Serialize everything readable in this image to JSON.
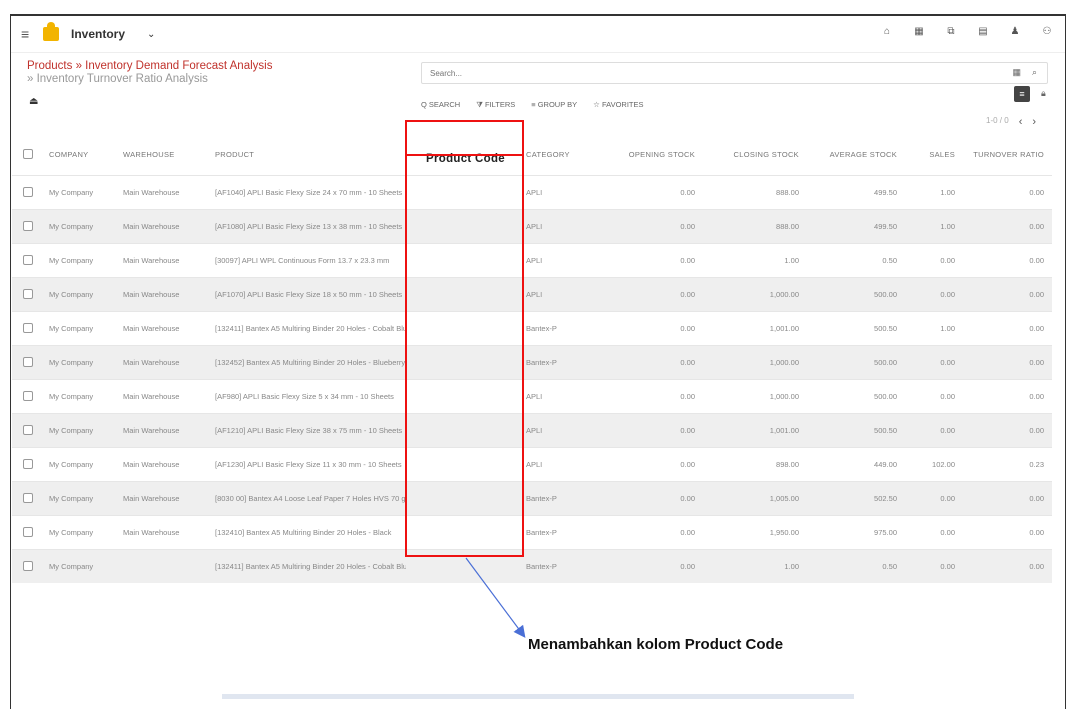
{
  "header": {
    "app_title": "Inventory",
    "menu_icon": "menu-icon",
    "app_icon": "inventory-app-icon",
    "dropdown_icon": "chevron-down-icon",
    "right_icons": [
      "home-icon",
      "grid-icon",
      "apps-icon",
      "chat-icon",
      "bell-icon",
      "avatar"
    ],
    "right_glyphs": [
      "⌂",
      "▦",
      "⧉",
      "▤",
      "♟",
      "⚇"
    ]
  },
  "breadcrumb": {
    "part1": "Products » Inventory Demand Forecast Analysis",
    "part2": "» Inventory Turnover Ratio Analysis"
  },
  "search": {
    "placeholder": "Search..."
  },
  "toolbar": {
    "search_label": "Q SEARCH",
    "filters_label": "⧩ FILTERS",
    "groupby_label": "≡ GROUP BY",
    "favorites_label": "☆ FAVORITES"
  },
  "pager": {
    "text": "1-0 / 0",
    "prev": "‹",
    "next": "›"
  },
  "table": {
    "headers": [
      "COMPANY",
      "WAREHOUSE",
      "PRODUCT",
      "Product Code",
      "CATEGORY",
      "OPENING STOCK",
      "CLOSING STOCK",
      "AVERAGE STOCK",
      "SALES",
      "TURNOVER RATIO"
    ],
    "rows": [
      [
        "My Company",
        "Main Warehouse",
        "[AF1040] APLI Basic Flexy Size 24 x 70 mm - 10 Sheets",
        "",
        "APLI",
        "0.00",
        "888.00",
        "499.50",
        "1.00",
        "0.00"
      ],
      [
        "My Company",
        "Main Warehouse",
        "[AF1080] APLI Basic Flexy Size 13 x 38 mm - 10 Sheets",
        "",
        "APLI",
        "0.00",
        "888.00",
        "499.50",
        "1.00",
        "0.00"
      ],
      [
        "My Company",
        "Main Warehouse",
        "[30097] APLI WPL Continuous Form 13.7 x 23.3 mm",
        "",
        "APLI",
        "0.00",
        "1.00",
        "0.50",
        "0.00",
        "0.00"
      ],
      [
        "My Company",
        "Main Warehouse",
        "[AF1070] APLI Basic Flexy Size 18 x 50 mm - 10 Sheets",
        "",
        "APLI",
        "0.00",
        "1,000.00",
        "500.00",
        "0.00",
        "0.00"
      ],
      [
        "My Company",
        "Main Warehouse",
        "[132411] Bantex A5 Multiring Binder 20 Holes - Cobalt Blue",
        "",
        "Bantex-P",
        "0.00",
        "1,001.00",
        "500.50",
        "1.00",
        "0.00"
      ],
      [
        "My Company",
        "Main Warehouse",
        "[132452] Bantex A5 Multiring Binder 20 Holes - Blueberry",
        "",
        "Bantex-P",
        "0.00",
        "1,000.00",
        "500.00",
        "0.00",
        "0.00"
      ],
      [
        "My Company",
        "Main Warehouse",
        "[AF980] APLI Basic Flexy Size 5 x 34 mm - 10 Sheets",
        "",
        "APLI",
        "0.00",
        "1,000.00",
        "500.00",
        "0.00",
        "0.00"
      ],
      [
        "My Company",
        "Main Warehouse",
        "[AF1210] APLI Basic Flexy Size 38 x 75 mm - 10 Sheets",
        "",
        "APLI",
        "0.00",
        "1,001.00",
        "500.50",
        "0.00",
        "0.00"
      ],
      [
        "My Company",
        "Main Warehouse",
        "[AF1230] APLI Basic Flexy Size 11 x 30 mm - 10 Sheets",
        "",
        "APLI",
        "0.00",
        "898.00",
        "449.00",
        "102.00",
        "0.23"
      ],
      [
        "My Company",
        "Main Warehouse",
        "[8030 00] Bantex A4 Loose Leaf Paper 7 Holes HVS 70 gr - 50 Sheets",
        "",
        "Bantex-P",
        "0.00",
        "1,005.00",
        "502.50",
        "0.00",
        "0.00"
      ],
      [
        "My Company",
        "Main Warehouse",
        "[132410] Bantex A5 Multiring Binder 20 Holes - Black",
        "",
        "Bantex-P",
        "0.00",
        "1,950.00",
        "975.00",
        "0.00",
        "0.00"
      ],
      [
        "My Company",
        "",
        "[132411] Bantex A5 Multiring Binder 20 Holes - Cobalt Blue",
        "",
        "Bantex-P",
        "0.00",
        "1.00",
        "0.50",
        "0.00",
        "0.00"
      ]
    ]
  },
  "annotation": {
    "caption": "Menambahkan kolom Product Code",
    "highlight_color": "#e11111",
    "arrow_color": "#4a6fd6"
  }
}
